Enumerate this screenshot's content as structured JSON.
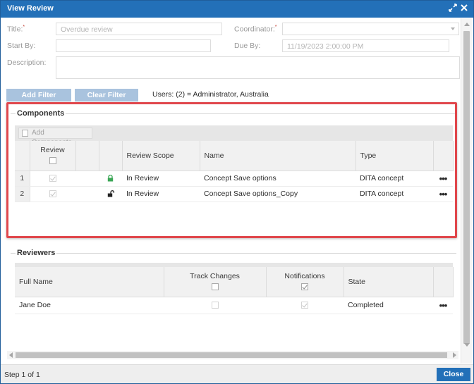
{
  "window": {
    "title": "View Review",
    "expand_icon": "expand-icon",
    "close_icon": "close-icon"
  },
  "form": {
    "title_label": "Title:",
    "title_value": "Overdue review",
    "coordinator_label": "Coordinator:",
    "coordinator_value": "",
    "start_by_label": "Start By:",
    "start_by_value": "",
    "due_by_label": "Due By:",
    "due_by_value": "11/19/2023 2:00:00 PM",
    "description_label": "Description:",
    "description_value": "",
    "required_mark": "*"
  },
  "filters": {
    "add_filter_label": "Add Filter",
    "clear_filter_label": "Clear Filter",
    "users_text": "Users: (2) = Administrator, Australia"
  },
  "components": {
    "section_title": "Components",
    "add_components_label": "Add Components...",
    "columns": {
      "review": "Review",
      "review_scope": "Review Scope",
      "name": "Name",
      "type": "Type"
    },
    "rows": [
      {
        "num": "1",
        "review_checked": true,
        "lock": "lock-closed-icon",
        "review_scope": "In Review",
        "name": "Concept Save options",
        "type": "DITA concept",
        "menu": "•••"
      },
      {
        "num": "2",
        "review_checked": true,
        "lock": "lock-open-icon",
        "review_scope": "In Review",
        "name": "Concept Save options_Copy",
        "type": "DITA concept",
        "menu": "•••"
      }
    ]
  },
  "reviewers": {
    "section_title": "Reviewers",
    "columns": {
      "full_name": "Full Name",
      "track_changes": "Track Changes",
      "notifications": "Notifications",
      "state": "State"
    },
    "rows": [
      {
        "full_name": "Jane Doe",
        "track_changes": false,
        "notifications": true,
        "state": "Completed",
        "menu": "•••"
      }
    ]
  },
  "footer": {
    "step_text": "Step 1 of 1",
    "close_label": "Close"
  },
  "colors": {
    "titlebar": "#2370b8",
    "highlight_border": "#e0474c",
    "button_light": "#a9c3de",
    "lock_green": "#3aa655"
  }
}
